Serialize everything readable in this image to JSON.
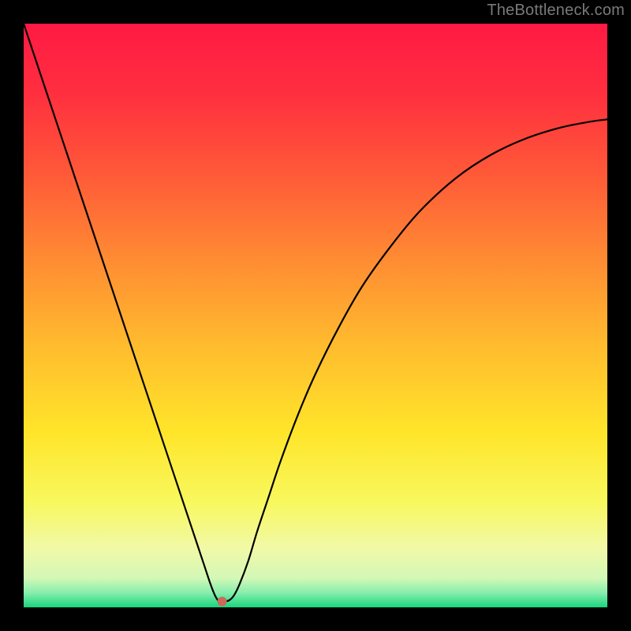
{
  "watermark": "TheBottleneck.com",
  "chart_data": {
    "type": "line",
    "title": "",
    "xlabel": "",
    "ylabel": "",
    "xlim": [
      0,
      100
    ],
    "ylim": [
      0,
      100
    ],
    "grid": false,
    "legend": false,
    "background_gradient": {
      "stops": [
        {
          "offset": 0.0,
          "color": "#ff1a43"
        },
        {
          "offset": 0.12,
          "color": "#ff2f3f"
        },
        {
          "offset": 0.26,
          "color": "#ff5a38"
        },
        {
          "offset": 0.4,
          "color": "#ff8a33"
        },
        {
          "offset": 0.55,
          "color": "#ffbb2e"
        },
        {
          "offset": 0.7,
          "color": "#ffe52a"
        },
        {
          "offset": 0.82,
          "color": "#f8f85e"
        },
        {
          "offset": 0.9,
          "color": "#f1f9a8"
        },
        {
          "offset": 0.95,
          "color": "#d3f8b6"
        },
        {
          "offset": 0.975,
          "color": "#88eead"
        },
        {
          "offset": 1.0,
          "color": "#17d57e"
        }
      ]
    },
    "series": [
      {
        "name": "bottleneck-curve",
        "color": "#000000",
        "x": [
          0.0,
          3.0,
          6.0,
          9.0,
          12.0,
          15.0,
          18.0,
          21.0,
          24.0,
          27.0,
          29.5,
          31.0,
          32.0,
          32.8,
          33.5,
          34.3,
          35.2,
          36.0,
          37.0,
          38.5,
          40.0,
          42.0,
          44.0,
          47.0,
          50.0,
          54.0,
          58.0,
          63.0,
          68.0,
          74.0,
          80.0,
          86.0,
          92.0,
          97.0,
          100.0
        ],
        "y": [
          100.0,
          91.0,
          82.0,
          73.0,
          64.0,
          55.0,
          46.0,
          37.0,
          28.0,
          19.0,
          11.5,
          7.0,
          4.0,
          2.0,
          1.0,
          1.0,
          1.2,
          2.0,
          4.0,
          8.0,
          13.0,
          19.0,
          25.0,
          33.0,
          40.0,
          48.0,
          55.0,
          62.0,
          68.0,
          73.5,
          77.5,
          80.3,
          82.2,
          83.2,
          83.6
        ]
      }
    ],
    "marker": {
      "name": "target-point",
      "x": 34.0,
      "y": 1.0,
      "color": "#c96a5a",
      "radius_px": 6
    }
  }
}
